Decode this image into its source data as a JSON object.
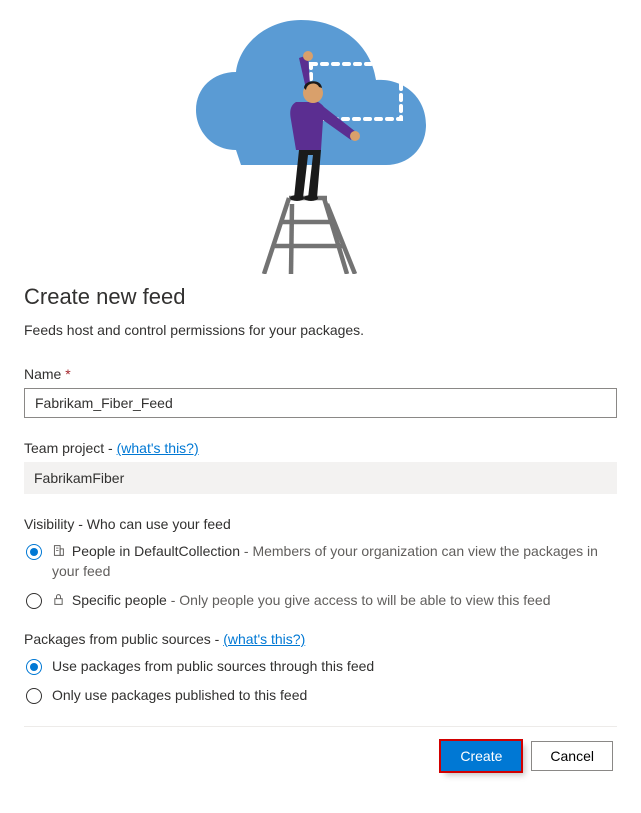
{
  "title": "Create new feed",
  "subtitle": "Feeds host and control permissions for your packages.",
  "name": {
    "label": "Name",
    "value": "Fabrikam_Fiber_Feed"
  },
  "team_project": {
    "label": "Team project - ",
    "link": "(what's this?)",
    "value": "FabrikamFiber"
  },
  "visibility": {
    "label": "Visibility - Who can use your feed",
    "options": [
      {
        "title": "People in DefaultCollection",
        "desc": " - Members of your organization can view the packages in your feed",
        "selected": true
      },
      {
        "title": "Specific people",
        "desc": " - Only people you give access to will be able to view this feed",
        "selected": false
      }
    ]
  },
  "packages": {
    "label": "Packages from public sources - ",
    "link": "(what's this?)",
    "options": [
      {
        "title": "Use packages from public sources through this feed",
        "selected": true
      },
      {
        "title": "Only use packages published to this feed",
        "selected": false
      }
    ]
  },
  "buttons": {
    "create": "Create",
    "cancel": "Cancel"
  }
}
